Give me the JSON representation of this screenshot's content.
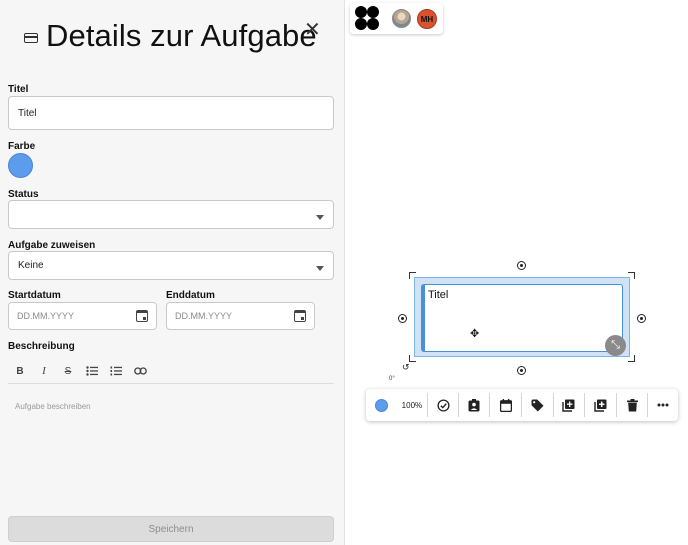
{
  "panel": {
    "title": "Details zur Aufgabe",
    "fields": {
      "title_label": "Titel",
      "title_value": "Titel",
      "color_label": "Farbe",
      "status_label": "Status",
      "status_value": "",
      "assign_label": "Aufgabe zuweisen",
      "assign_value": "Keine",
      "start_label": "Startdatum",
      "start_placeholder": "DD.MM.YYYY",
      "end_label": "Enddatum",
      "end_placeholder": "DD.MM.YYYY",
      "description_label": "Beschreibung",
      "description_placeholder": "Aufgabe beschreiben"
    },
    "editor_toolbar": [
      "B",
      "I",
      "S"
    ],
    "save_label": "Speichern"
  },
  "top_bar": {
    "avatar_initials": "MH"
  },
  "canvas": {
    "card_title": "Titel",
    "rotation": "0°"
  },
  "toolbar": {
    "zoom": "100%"
  },
  "colors": {
    "accent": "#5b9cec",
    "card_border": "#4d8fd6",
    "avatar_bg": "#d9532f",
    "save_disabled_bg": "#dcdcdc"
  },
  "icons": [
    "credit-card-icon",
    "close-icon",
    "chevron-down-icon",
    "calendar-icon",
    "bold-icon",
    "italic-icon",
    "strikethrough-icon",
    "bullet-list-icon",
    "numbered-list-icon",
    "link-icon",
    "move-icon",
    "resize-icon",
    "rotate-icon",
    "check-circle-icon",
    "assign-icon",
    "calendar-icon",
    "tag-icon",
    "duplicate-icon",
    "add-icon",
    "trash-icon",
    "more-icon"
  ]
}
